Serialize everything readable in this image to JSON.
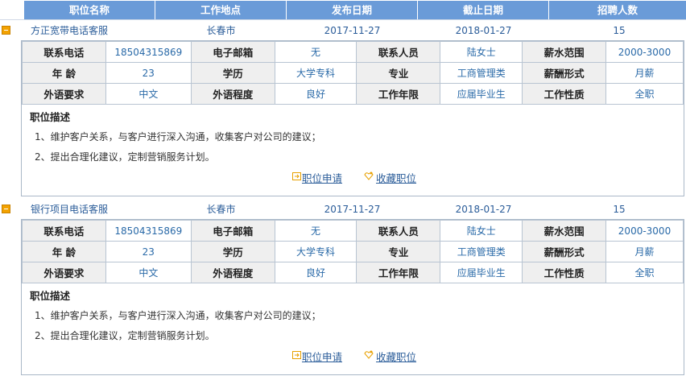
{
  "header": {
    "columns": [
      "职位名称",
      "工作地点",
      "发布日期",
      "截止日期",
      "招聘人数"
    ]
  },
  "labels": {
    "phone": "联系电话",
    "email": "电子邮箱",
    "contact": "联系人员",
    "salary_range": "薪水范围",
    "age": "年 龄",
    "education": "学历",
    "major": "专业",
    "salary_form": "薪酬形式",
    "language": "外语要求",
    "language_level": "外语程度",
    "experience": "工作年限",
    "nature": "工作性质",
    "desc_title": "职位描述",
    "apply": "职位申请",
    "favorite": "收藏职位"
  },
  "jobs": [
    {
      "title": "方正宽带电话客服",
      "location": "长春市",
      "publish_date": "2017-11-27",
      "deadline": "2018-01-27",
      "headcount": "15",
      "phone": "18504315869",
      "email": "无",
      "contact": "陆女士",
      "salary_range": "2000-3000",
      "age": "23",
      "education": "大学专科",
      "major": "工商管理类",
      "salary_form": "月薪",
      "language": "中文",
      "language_level": "良好",
      "experience": "应届毕业生",
      "nature": "全职",
      "desc": [
        "1、维护客户关系，与客户进行深入沟通，收集客户对公司的建议；",
        "2、提出合理化建议，定制营销服务计划。"
      ]
    },
    {
      "title": "银行项目电话客服",
      "location": "长春市",
      "publish_date": "2017-11-27",
      "deadline": "2018-01-27",
      "headcount": "15",
      "phone": "18504315869",
      "email": "无",
      "contact": "陆女士",
      "salary_range": "2000-3000",
      "age": "23",
      "education": "大学专科",
      "major": "工商管理类",
      "salary_form": "月薪",
      "language": "中文",
      "language_level": "良好",
      "experience": "应届毕业生",
      "nature": "全职",
      "desc": [
        "1、维护客户关系，与客户进行深入沟通，收集客户对公司的建议；",
        "2、提出合理化建议，定制营销服务计划。"
      ]
    }
  ]
}
